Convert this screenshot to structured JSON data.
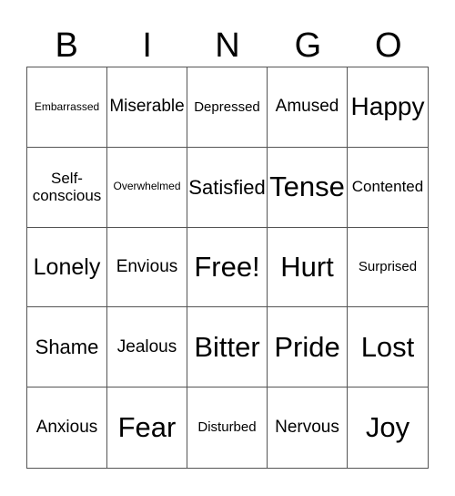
{
  "header": {
    "letters": [
      "B",
      "I",
      "N",
      "G",
      "O"
    ]
  },
  "card": {
    "rows": [
      [
        "Embarrassed",
        "Miserable",
        "Depressed",
        "Amused",
        "Happy"
      ],
      [
        "Self-conscious",
        "Overwhelmed",
        "Satisfied",
        "Tense",
        "Contented"
      ],
      [
        "Lonely",
        "Envious",
        "Free!",
        "Hurt",
        "Surprised"
      ],
      [
        "Shame",
        "Jealous",
        "Bitter",
        "Pride",
        "Lost"
      ],
      [
        "Anxious",
        "Fear",
        "Disturbed",
        "Nervous",
        "Joy"
      ]
    ],
    "free_space": "Free!"
  }
}
